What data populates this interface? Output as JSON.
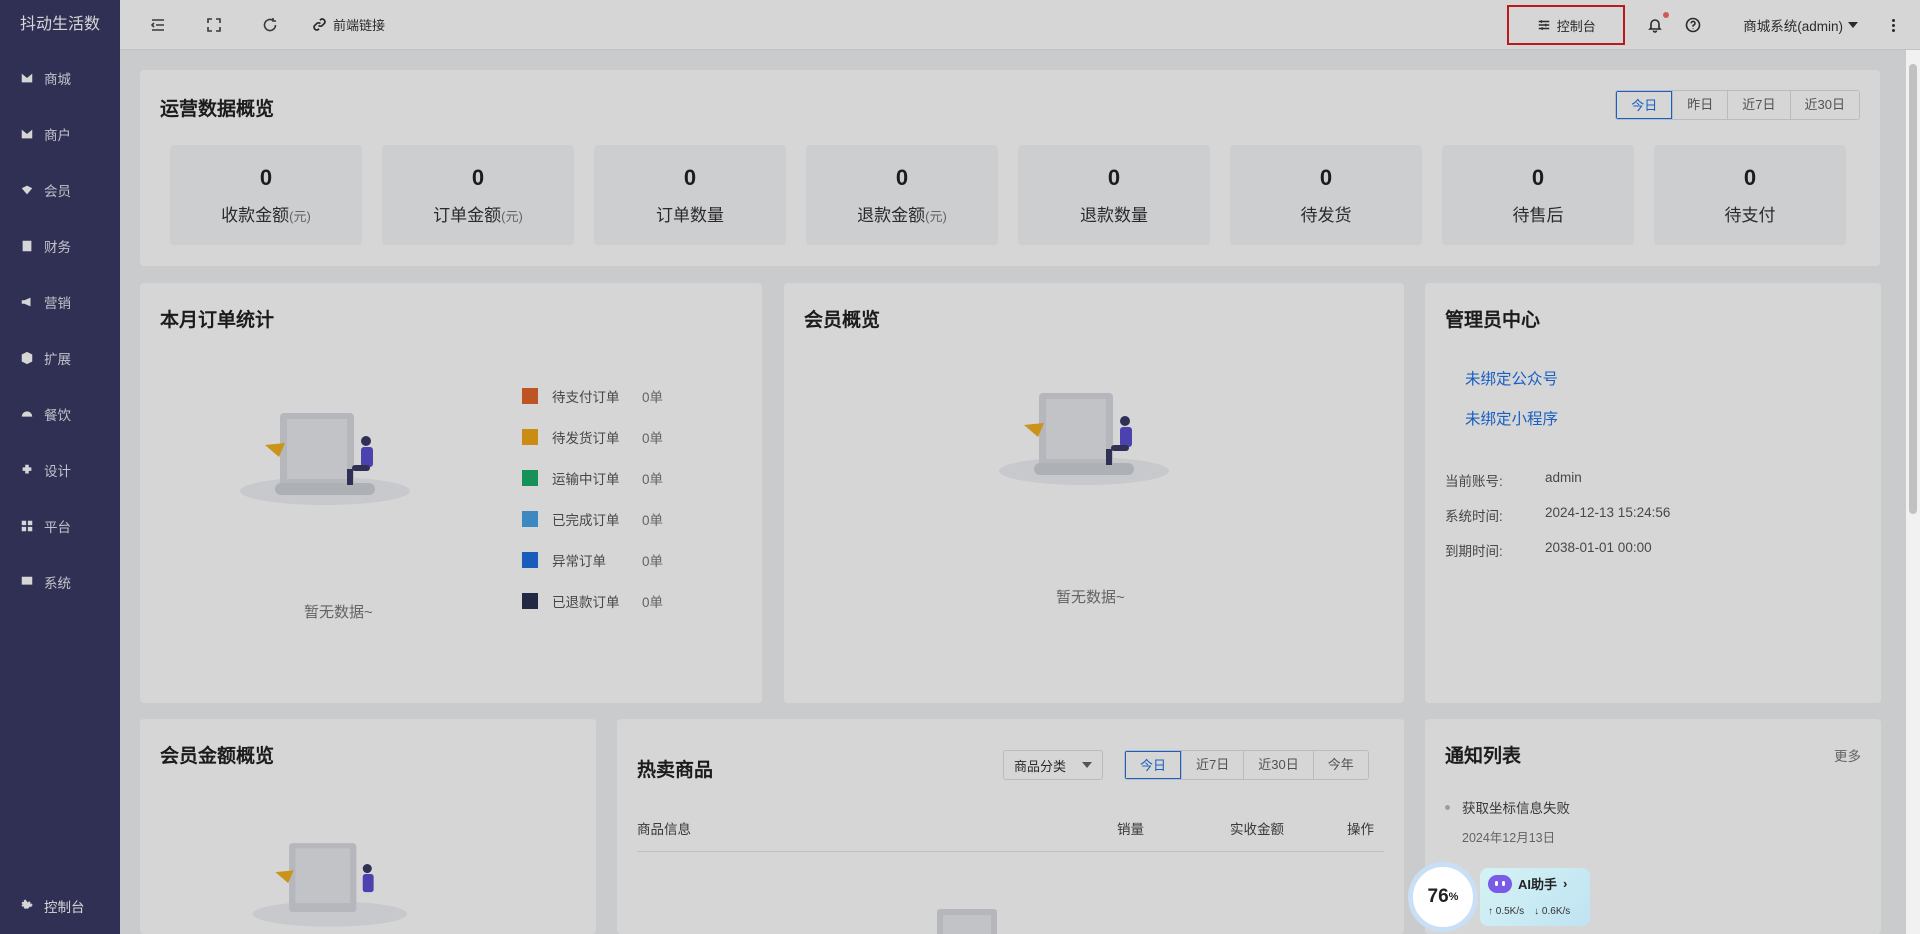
{
  "sidebar": {
    "brand": "抖动生活数",
    "items": [
      {
        "label": "商城",
        "icon": "mall-icon"
      },
      {
        "label": "商户",
        "icon": "merchant-icon"
      },
      {
        "label": "会员",
        "icon": "member-icon"
      },
      {
        "label": "财务",
        "icon": "finance-icon"
      },
      {
        "label": "营销",
        "icon": "marketing-icon"
      },
      {
        "label": "扩展",
        "icon": "extension-icon"
      },
      {
        "label": "餐饮",
        "icon": "catering-icon"
      },
      {
        "label": "设计",
        "icon": "design-icon"
      },
      {
        "label": "平台",
        "icon": "platform-icon"
      },
      {
        "label": "系统",
        "icon": "system-icon"
      }
    ],
    "bottom_label": "控制台"
  },
  "header": {
    "frontend_link": "前端链接",
    "console": "控制台",
    "user": "商城系统(admin)"
  },
  "overview": {
    "title": "运营数据概览",
    "ranges": [
      "今日",
      "昨日",
      "近7日",
      "近30日"
    ],
    "stats": [
      {
        "value": "0",
        "label": "收款金额",
        "unit": "(元)"
      },
      {
        "value": "0",
        "label": "订单金额",
        "unit": "(元)"
      },
      {
        "value": "0",
        "label": "订单数量",
        "unit": ""
      },
      {
        "value": "0",
        "label": "退款金额",
        "unit": "(元)"
      },
      {
        "value": "0",
        "label": "退款数量",
        "unit": ""
      },
      {
        "value": "0",
        "label": "待发货",
        "unit": ""
      },
      {
        "value": "0",
        "label": "待售后",
        "unit": ""
      },
      {
        "value": "0",
        "label": "待支付",
        "unit": ""
      }
    ]
  },
  "monthly_orders": {
    "title": "本月订单统计",
    "empty": "暂无数据~",
    "legend": [
      {
        "name": "待支付订单",
        "value": "0单",
        "color": "#e0652a"
      },
      {
        "name": "待发货订单",
        "value": "0单",
        "color": "#f2a71b"
      },
      {
        "name": "运输中订单",
        "value": "0单",
        "color": "#1aad6b"
      },
      {
        "name": "已完成订单",
        "value": "0单",
        "color": "#4aa3e8"
      },
      {
        "name": "异常订单",
        "value": "0单",
        "color": "#1e6fe0"
      },
      {
        "name": "已退款订单",
        "value": "0单",
        "color": "#2a3050"
      }
    ]
  },
  "member_overview": {
    "title": "会员概览",
    "empty": "暂无数据~"
  },
  "admin_center": {
    "title": "管理员中心",
    "links": [
      "未绑定公众号",
      "未绑定小程序"
    ],
    "info": [
      {
        "key": "当前账号:",
        "value": "admin"
      },
      {
        "key": "系统时间:",
        "value": "2024-12-13 15:24:56"
      },
      {
        "key": "到期时间:",
        "value": "2038-01-01 00:00"
      }
    ]
  },
  "member_amount": {
    "title": "会员金额概览"
  },
  "hot_products": {
    "title": "热卖商品",
    "category_select": "商品分类",
    "ranges": [
      "今日",
      "近7日",
      "近30日",
      "今年"
    ],
    "columns": [
      "商品信息",
      "销量",
      "实收金额",
      "操作"
    ]
  },
  "notices": {
    "title": "通知列表",
    "more": "更多",
    "items": [
      {
        "text": "获取坐标信息失败",
        "date": "2024年12月13日"
      }
    ]
  },
  "ai_widget": {
    "percent": "76",
    "percent_unit": "%",
    "title": "AI助手",
    "up": "0.5K/s",
    "down": "0.6K/s"
  }
}
